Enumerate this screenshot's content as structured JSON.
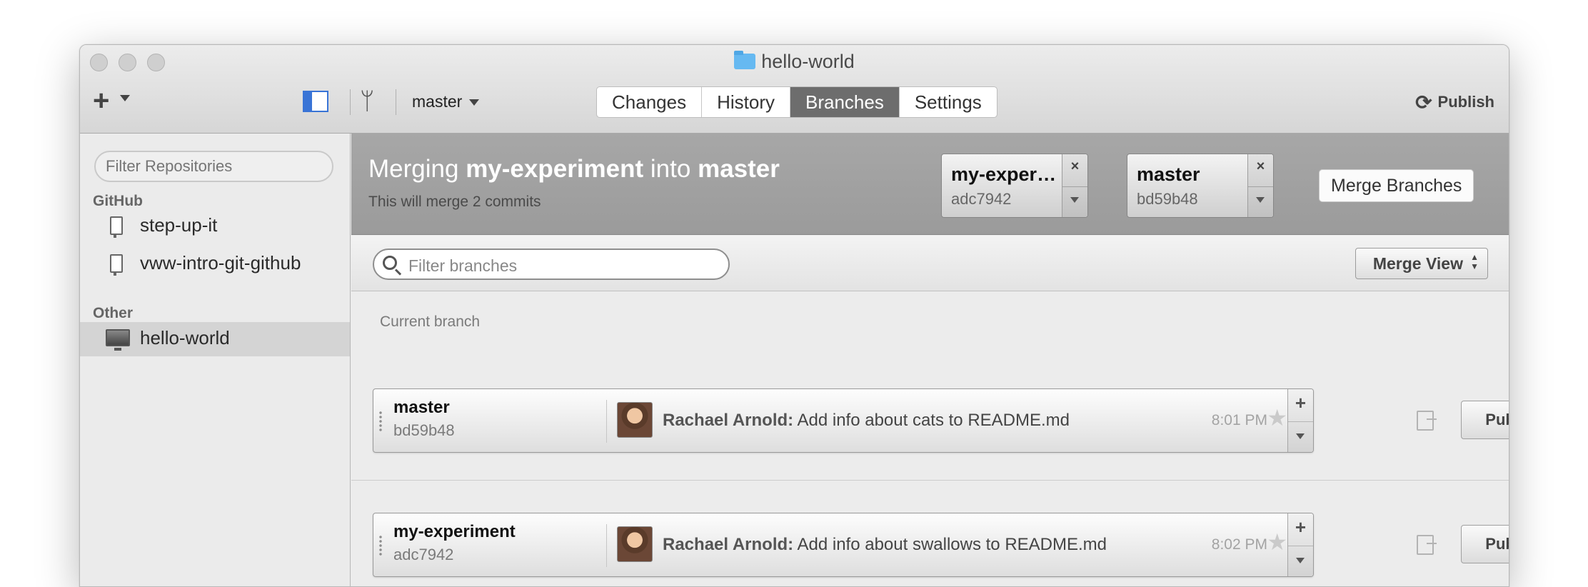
{
  "window": {
    "title": "hello-world"
  },
  "toolbar": {
    "branch": "master",
    "tabs": [
      "Changes",
      "History",
      "Branches",
      "Settings"
    ],
    "active_tab": "Branches",
    "publish_label": "Publish"
  },
  "sidebar": {
    "filter_placeholder": "Filter Repositories",
    "sections": [
      {
        "label": "GitHub",
        "items": [
          "step-up-it",
          "vww-intro-git-github"
        ]
      },
      {
        "label": "Other",
        "items": [
          "hello-world"
        ]
      }
    ],
    "selected": "hello-world"
  },
  "merge": {
    "title_prefix": "Merging",
    "source": "my-experiment",
    "middle": "into",
    "target": "master",
    "subtitle": "This will merge 2 commits",
    "source_card": {
      "name": "my-exper…",
      "sha": "adc7942"
    },
    "target_card": {
      "name": "master",
      "sha": "bd59b48"
    },
    "button": "Merge Branches"
  },
  "branches_panel": {
    "filter_placeholder": "Filter branches",
    "merge_view": "Merge View",
    "current_label": "Current branch",
    "publish_label": "Publish",
    "rows": [
      {
        "name": "master",
        "sha": "bd59b48",
        "author": "Rachael Arnold:",
        "message": "Add info about cats to README.md",
        "time": "8:01 PM"
      },
      {
        "name": "my-experiment",
        "sha": "adc7942",
        "author": "Rachael Arnold:",
        "message": "Add info about swallows to README.md",
        "time": "8:02 PM"
      }
    ]
  },
  "colors": {
    "active_tab": "#6d6d6d",
    "merge_bar": "#a3a3a3",
    "sidebar_toggle": "#3974d6"
  }
}
